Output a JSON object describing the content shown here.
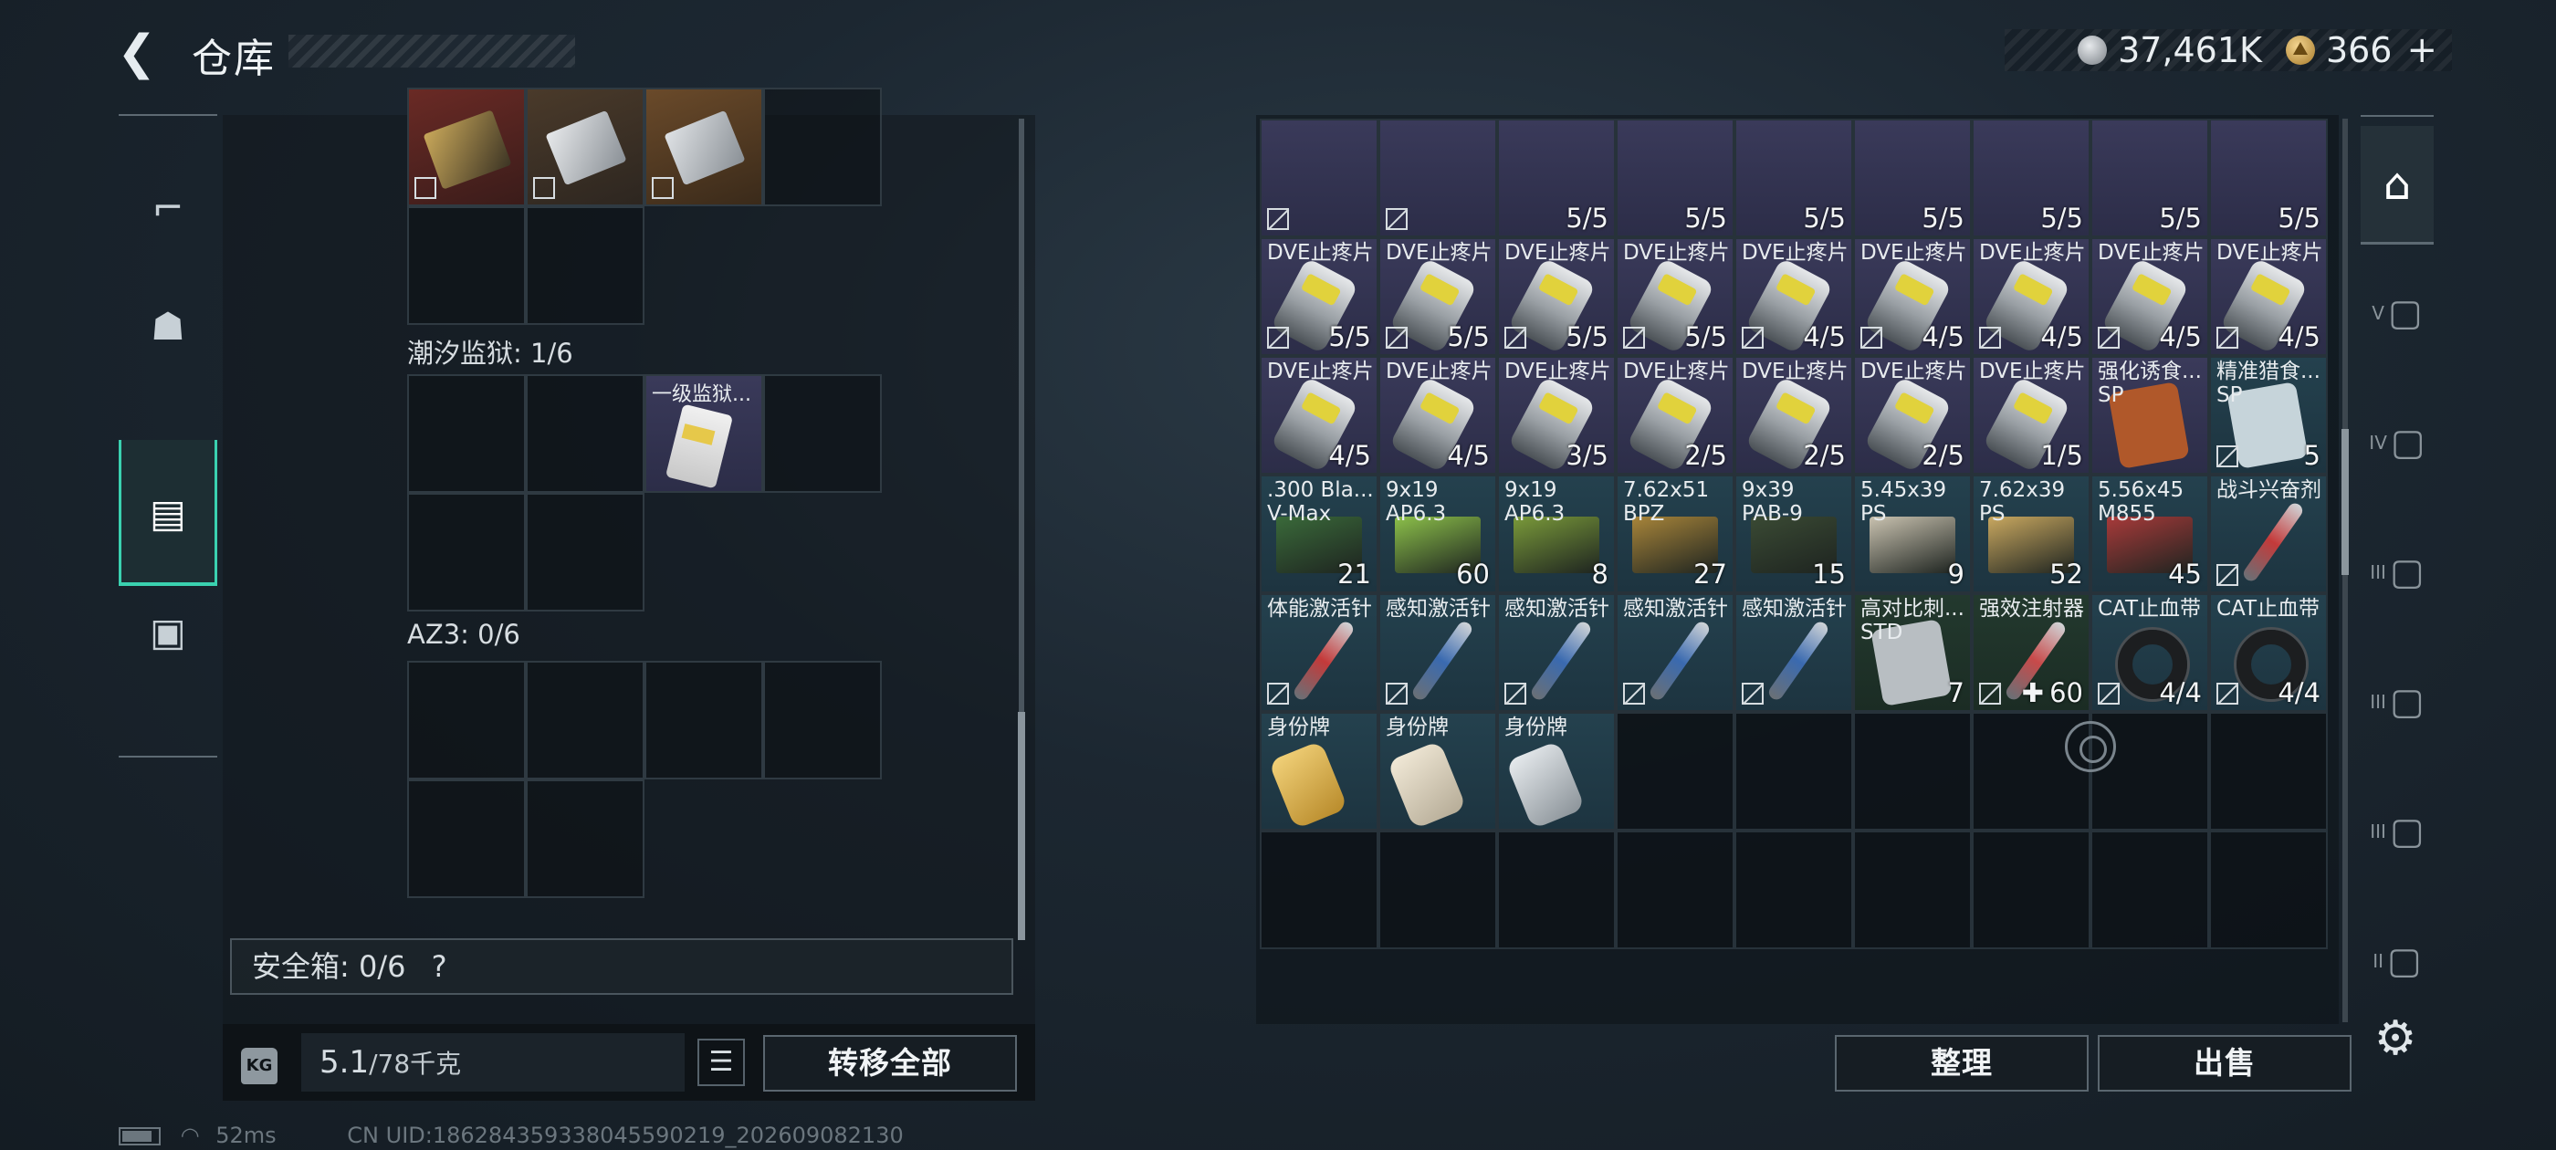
{
  "header": {
    "back_icon": "back-arrow-icon",
    "title": "仓库"
  },
  "currency": {
    "silver": "37,461K",
    "gold": "366",
    "add": "+"
  },
  "left_nav": [
    {
      "icon": "pistol-icon"
    },
    {
      "icon": "vest-icon"
    },
    {
      "icon": "backpack-icon",
      "active": true
    },
    {
      "icon": "toolbox-icon"
    }
  ],
  "containers": [
    {
      "label": "潮汐监狱: 1/6",
      "item_name": "一级监狱..."
    },
    {
      "label": "AZ3: 0/6"
    }
  ],
  "safe_box": {
    "label": "安全箱: 0/6",
    "help": "?"
  },
  "weight": {
    "current": "5.1",
    "max": "/78千克",
    "icon_text": "KG"
  },
  "buttons": {
    "transfer_all": "转移全部",
    "sort": "整理",
    "sell": "出售"
  },
  "inventory": {
    "row0": [
      "",
      "",
      "5/5",
      "5/5",
      "5/5",
      "5/5",
      "5/5",
      "5/5",
      "5/5"
    ],
    "row1": [
      {
        "name": "DVE止疼片",
        "count": "5/5"
      },
      {
        "name": "DVE止疼片",
        "count": "5/5"
      },
      {
        "name": "DVE止疼片",
        "count": "5/5"
      },
      {
        "name": "DVE止疼片",
        "count": "5/5"
      },
      {
        "name": "DVE止疼片",
        "count": "4/5"
      },
      {
        "name": "DVE止疼片",
        "count": "4/5"
      },
      {
        "name": "DVE止疼片",
        "count": "4/5"
      },
      {
        "name": "DVE止疼片",
        "count": "4/5"
      },
      {
        "name": "DVE止疼片",
        "count": "4/5"
      }
    ],
    "row2": [
      {
        "name": "DVE止疼片",
        "count": "4/5"
      },
      {
        "name": "DVE止疼片",
        "count": "4/5"
      },
      {
        "name": "DVE止疼片",
        "count": "3/5"
      },
      {
        "name": "DVE止疼片",
        "count": "2/5"
      },
      {
        "name": "DVE止疼片",
        "count": "2/5"
      },
      {
        "name": "DVE止疼片",
        "count": "2/5"
      },
      {
        "name": "DVE止疼片",
        "count": "1/5"
      },
      {
        "name": "强化诱食...",
        "sub": "SP",
        "count": ""
      },
      {
        "name": "精准猎食...",
        "sub": "SP",
        "count": "5"
      }
    ],
    "row3": [
      {
        "name": ".300 Bla...",
        "sub": "V-Max",
        "count": "21"
      },
      {
        "name": "9x19",
        "sub": "AP6.3",
        "count": "60"
      },
      {
        "name": "9x19",
        "sub": "AP6.3",
        "count": "8"
      },
      {
        "name": "7.62x51",
        "sub": "BPZ",
        "count": "27"
      },
      {
        "name": "9x39",
        "sub": "PAB-9",
        "count": "15"
      },
      {
        "name": "5.45x39",
        "sub": "PS",
        "count": "9"
      },
      {
        "name": "7.62x39",
        "sub": "PS",
        "count": "52"
      },
      {
        "name": "5.56x45",
        "sub": "M855",
        "count": "45"
      },
      {
        "name": "战斗兴奋剂",
        "count": ""
      }
    ],
    "row4": [
      {
        "name": "体能激活针",
        "count": ""
      },
      {
        "name": "感知激活针",
        "count": ""
      },
      {
        "name": "感知激活针",
        "count": ""
      },
      {
        "name": "感知激活针",
        "count": ""
      },
      {
        "name": "感知激活针",
        "count": ""
      },
      {
        "name": "高对比刺...",
        "sub": "STD",
        "count": "7"
      },
      {
        "name": "强效注射器",
        "count": "60",
        "prefix": "✚"
      },
      {
        "name": "CAT止血带",
        "count": "4/4"
      },
      {
        "name": "CAT止血带",
        "count": "4/4"
      }
    ],
    "row5": [
      {
        "name": "身份牌"
      },
      {
        "name": "身份牌"
      },
      {
        "name": "身份牌"
      }
    ]
  },
  "side_nav": [
    {
      "icon": "bag-container-icon",
      "active": true
    },
    {
      "icon": "container-v-icon",
      "tier": "V"
    },
    {
      "icon": "container-iv-icon",
      "tier": "IV"
    },
    {
      "icon": "container-iii-icon",
      "tier": "III"
    },
    {
      "icon": "container-iii-icon",
      "tier": "III"
    },
    {
      "icon": "container-iii-icon",
      "tier": "III"
    },
    {
      "icon": "container-ii-icon",
      "tier": "II"
    }
  ],
  "status_bar": {
    "ping": "52ms",
    "uid": "CN UID:186284359338045590219_202609082130"
  },
  "colors": {
    "accent": "#3ad1b0",
    "rare_purple": "#3a3a5a",
    "uncommon_teal": "#24414e",
    "common_green": "#23392e"
  }
}
